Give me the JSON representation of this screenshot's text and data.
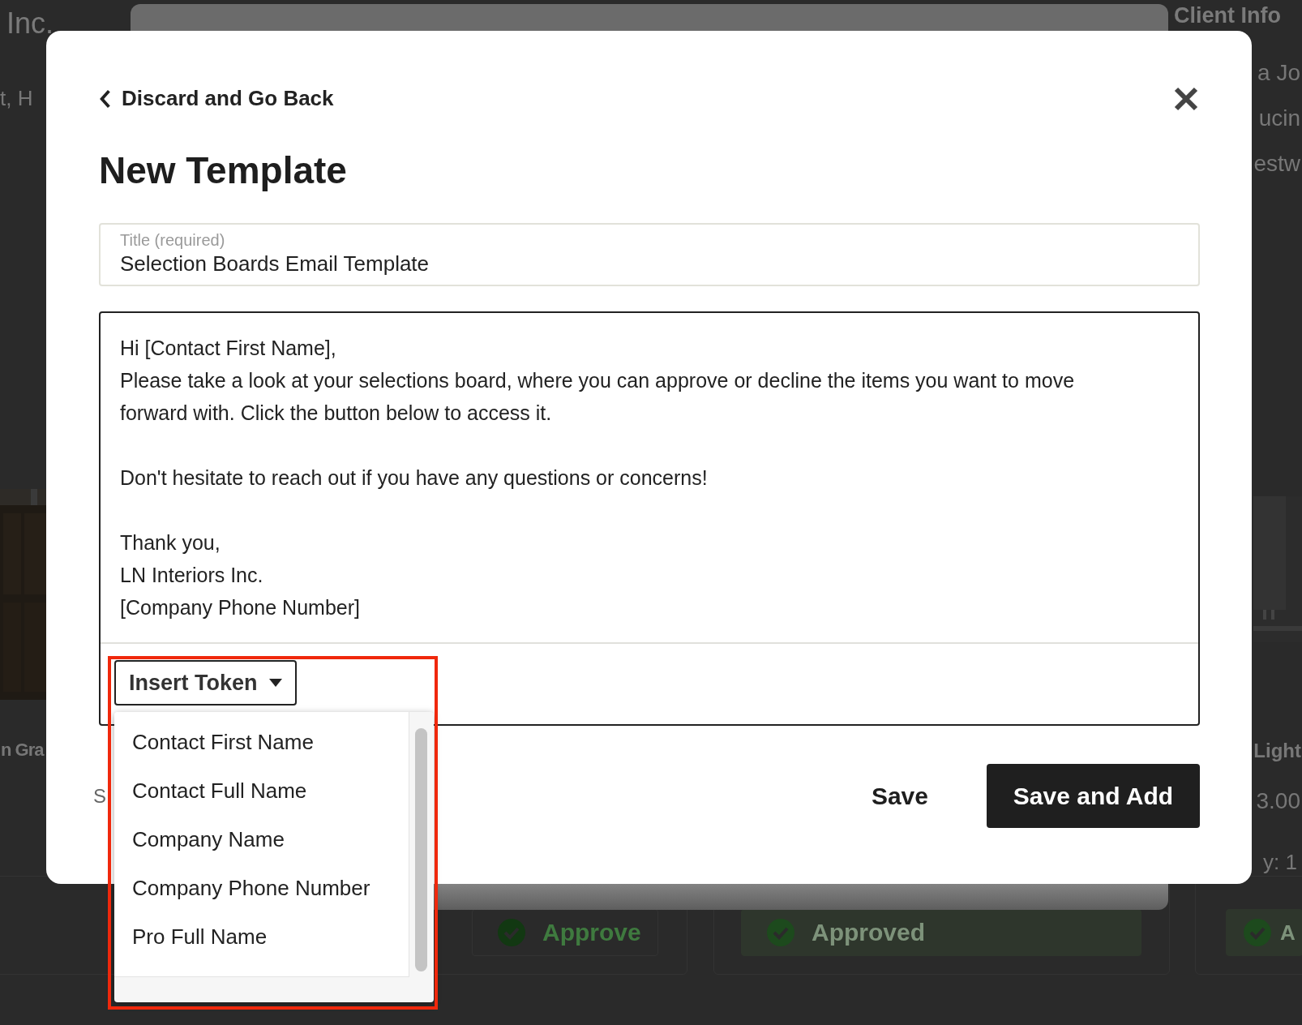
{
  "background": {
    "header_title": "Inc.",
    "header_subtitle": "t, H",
    "side_panel_title": "Client Info",
    "side_panel_lines": [
      "a Jo",
      "ucin",
      "estw"
    ],
    "left_card_title": "n Gra",
    "right_card_title": "Light",
    "right_card_price": "3.00",
    "right_card_quantity": "y: 1",
    "approve_buttons": [
      {
        "label": "Approve",
        "approved": false
      },
      {
        "label": "Approved",
        "approved": true
      },
      {
        "label": "A",
        "approved": true
      }
    ]
  },
  "modal": {
    "back_link": "Discard and Go Back",
    "title": "New Template",
    "title_field": {
      "label": "Title (required)",
      "value": "Selection Boards Email Template"
    },
    "body_paragraphs": [
      [
        "Hi [Contact First Name],",
        "Please take a look at your selections board, where you can approve or decline the items you want to move forward with. Click the button below to access it."
      ],
      [
        "Don't hesitate to reach out if you have any questions or concerns!"
      ],
      [
        "Thank you,",
        "LN Interiors Inc.",
        "[Company Phone Number]"
      ]
    ],
    "insert_token_button": "Insert Token",
    "token_menu": [
      "Contact First Name",
      "Contact Full Name",
      "Company Name",
      "Company Phone Number",
      "Pro Full Name"
    ],
    "footer_partial_text": "S",
    "save_button": "Save",
    "save_and_add_button": "Save and Add"
  }
}
